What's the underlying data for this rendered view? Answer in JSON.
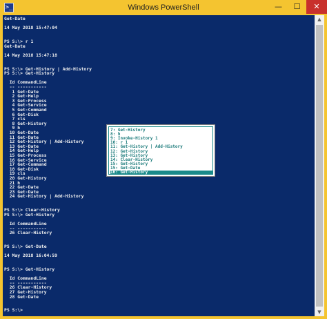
{
  "window": {
    "title": "Windows PowerShell",
    "icon_glyph": ">_",
    "minimize_glyph": "—",
    "maximize_glyph": "☐",
    "close_glyph": "✕"
  },
  "colors": {
    "titlebar": "#f4c430",
    "console_bg": "#0a2a6a",
    "console_text": "#f0f0f0",
    "popup_text": "#1a7a7a",
    "popup_selected_bg": "#1a8a8a"
  },
  "console_lines": [
    "Get-Date",
    "",
    "14 May 2018 15:47:04",
    "",
    "",
    "PS S:\\> r 1",
    "Get-Date",
    "",
    "14 May 2018 15:47:18",
    "",
    "",
    "PS S:\\> Get-History | Add-History",
    "PS S:\\> Get-History",
    "",
    "  Id CommandLine",
    "  -- -----------",
    "   1 Get-Date",
    "   2 Get-Help",
    "   3 Get-Process",
    "   4 Get-Service",
    "   5 Get-Command",
    "   6 Get-Disk",
    "   7 cls",
    "   8 Get-History",
    "   9 h",
    "  10 Get-Date",
    "  11 Get-Date",
    "  12 Get-History | Add-History",
    "  13 Get-Date",
    "  14 Get-Help",
    "  15 Get-Process",
    "  16 Get-Service",
    "  17 Get-Command",
    "  18 Get-Disk",
    "  19 cls",
    "  20 Get-History",
    "  21 h",
    "  22 Get-Date",
    "  23 Get-Date",
    "  24 Get-History | Add-History",
    "",
    "",
    "PS S:\\> Clear-History",
    "PS S:\\> Get-History",
    "",
    "  Id CommandLine",
    "  -- -----------",
    "  26 Clear-History",
    "",
    "",
    "PS S:\\> Get-Date",
    "",
    "14 May 2018 16:04:59",
    "",
    "",
    "PS S:\\> Get-History",
    "",
    "  Id CommandLine",
    "  -- -----------",
    "  26 Clear-History",
    "  27 Get-History",
    "  28 Get-Date",
    "",
    "",
    "PS S:\\>"
  ],
  "history_popup": {
    "items": [
      "7: Get-History",
      "8: h",
      "9: Invoke-History 1",
      "10: r 1",
      "11: Get-History | Add-History",
      "12: Get-History",
      "13: Get-History",
      "14: Clear-History",
      "15: Get-History",
      "15: Get-Date",
      "16: Get-History"
    ],
    "selected_index": 10
  }
}
